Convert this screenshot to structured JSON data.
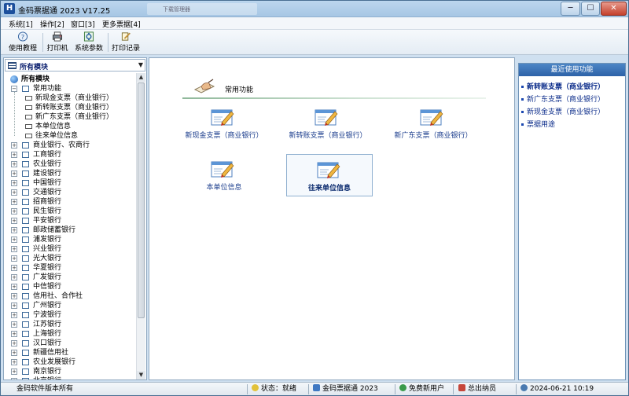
{
  "window": {
    "title": "金码票据通 2023  V17.25",
    "ghost_tab": "下载管理器",
    "min_glyph": "─",
    "max_glyph": "☐",
    "close_glyph": "✕"
  },
  "menu": [
    "系统[1]",
    "操作[2]",
    "窗口[3]",
    "更多票据[4]"
  ],
  "toolbar": [
    {
      "label": "使用教程",
      "icon": "help-icon"
    },
    {
      "label": "打印机",
      "icon": "printer-icon"
    },
    {
      "label": "系统参数",
      "icon": "settings-icon"
    },
    {
      "label": "打印记录",
      "icon": "print-record-icon"
    }
  ],
  "left": {
    "module_select": "所有模块",
    "root": "所有模块",
    "common_group": "常用功能",
    "common_items": [
      "新现金支票（商业银行）",
      "新转账支票（商业银行）",
      "新广东支票（商业银行）",
      "本单位信息",
      "往来单位信息"
    ],
    "banks": [
      "商业银行、农商行",
      "工商银行",
      "农业银行",
      "建设银行",
      "中国银行",
      "交通银行",
      "招商银行",
      "民生银行",
      "平安银行",
      "邮政储蓄银行",
      "浦发银行",
      "兴业银行",
      "光大银行",
      "华夏银行",
      "广发银行",
      "中信银行",
      "信用社、合作社",
      "广州银行",
      "宁波银行",
      "江苏银行",
      "上海银行",
      "汉口银行",
      "新疆信用社",
      "农业发展银行",
      "南京银行",
      "北京银行"
    ]
  },
  "center": {
    "section_title": "常用功能",
    "functions": [
      {
        "label": "新现金支票（商业银行）",
        "active": false
      },
      {
        "label": "新转账支票（商业银行）",
        "active": false
      },
      {
        "label": "新广东支票（商业银行）",
        "active": false
      },
      {
        "label": "本单位信息",
        "active": false
      },
      {
        "label": "往来单位信息",
        "active": true
      }
    ]
  },
  "right": {
    "title": "最近使用功能",
    "items": [
      "新转账支票（商业银行）",
      "新广东支票（商业银行）",
      "新现金支票（商业银行）",
      "票据用途"
    ]
  },
  "status": {
    "copyright": "金码软件版本所有",
    "state": "状态：就绪",
    "app": "金码票据通 2023",
    "user": "免费新用户",
    "role": "总出纳员",
    "datetime": "2024-06-21 10:19"
  },
  "colors": {
    "accent": "#2d62a8",
    "link": "#1a3c8c"
  }
}
